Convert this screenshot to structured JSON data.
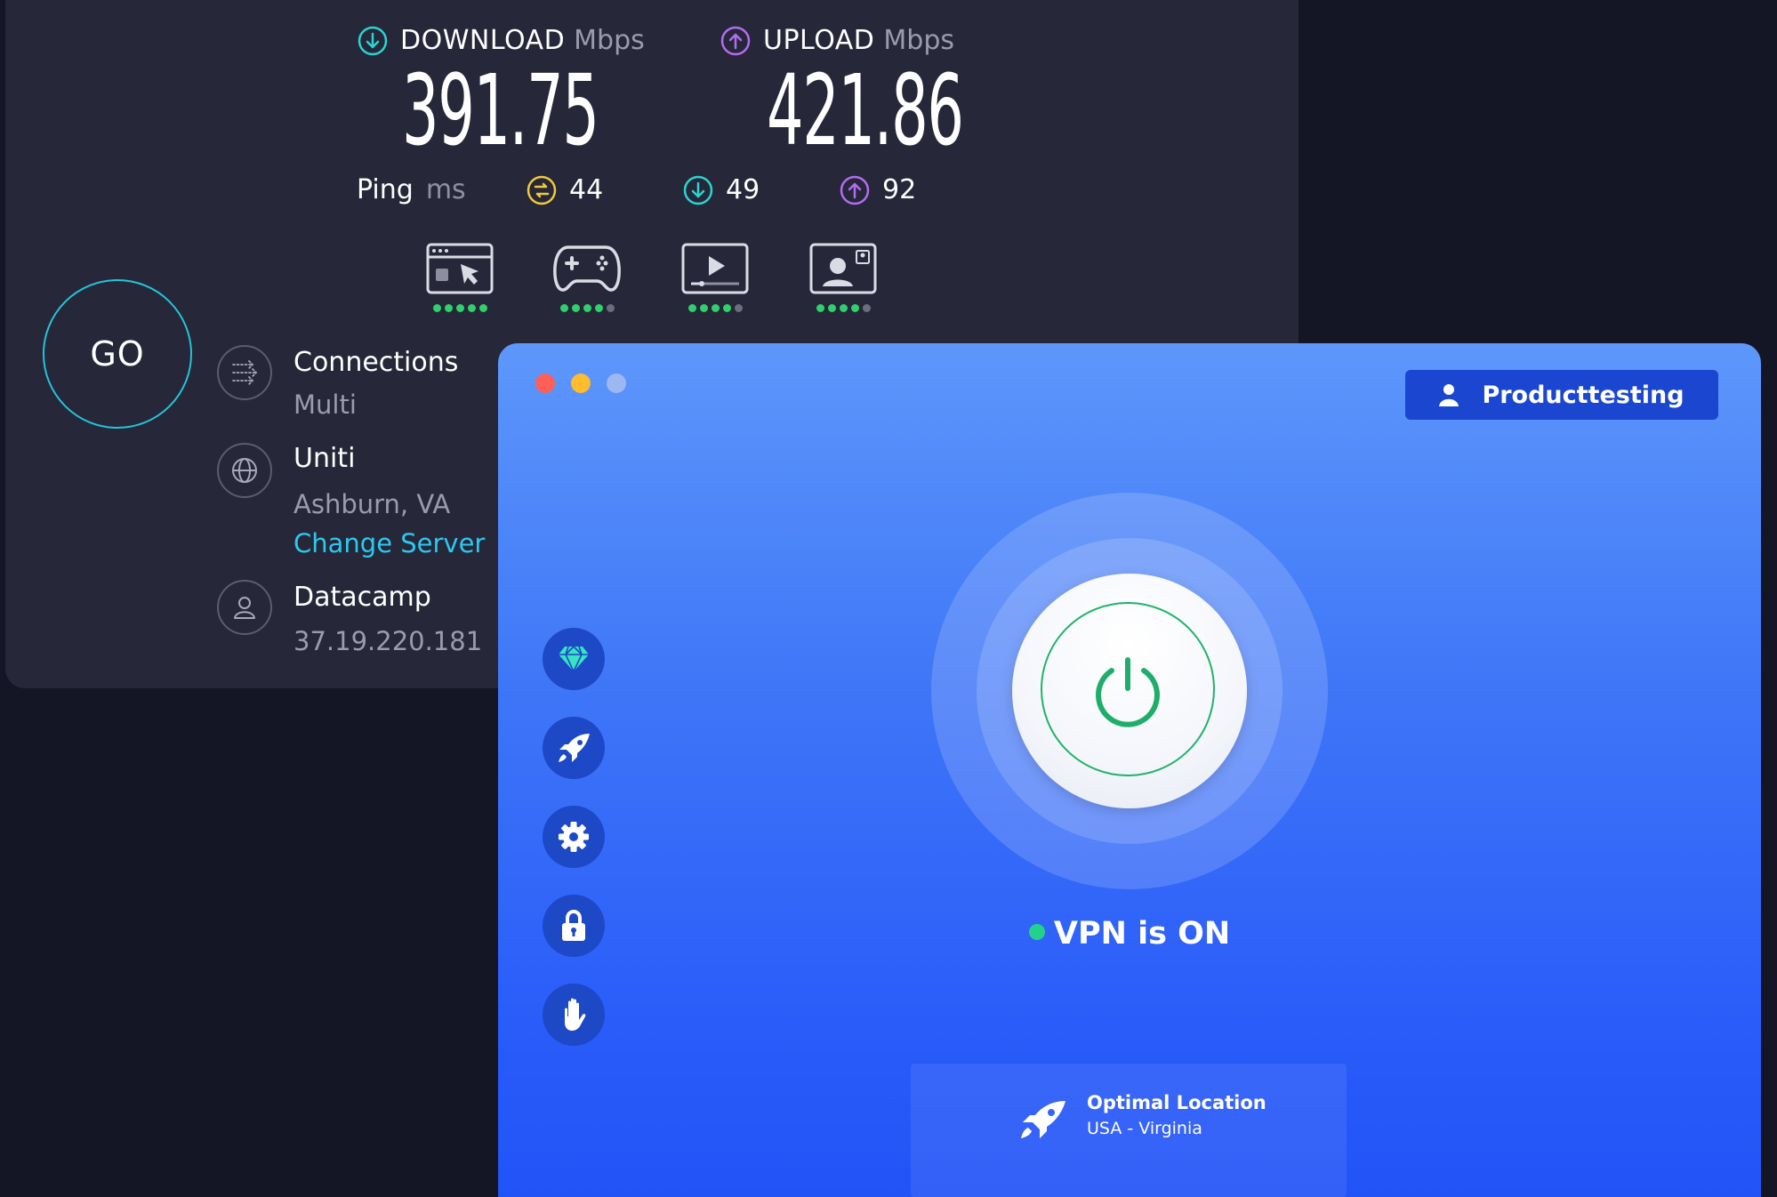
{
  "speedtest": {
    "download": {
      "label": "DOWNLOAD",
      "unit": "Mbps",
      "value": "391.75",
      "icon": "arrow-down-circle-icon",
      "color": "#2ad4d0"
    },
    "upload": {
      "label": "UPLOAD",
      "unit": "Mbps",
      "value": "421.86",
      "icon": "arrow-up-circle-icon",
      "color": "#b36cf0"
    },
    "ping": {
      "label": "Ping",
      "unit": "ms",
      "idle": {
        "value": "44",
        "icon": "ping-idle-icon",
        "color": "#f0c93c"
      },
      "download": {
        "value": "49",
        "icon": "arrow-down-circle-icon",
        "color": "#2ad4d0"
      },
      "upload": {
        "value": "92",
        "icon": "arrow-up-circle-icon",
        "color": "#b36cf0"
      }
    },
    "activities": [
      {
        "icon": "web-browsing-icon",
        "rating": 5
      },
      {
        "icon": "gaming-controller-icon",
        "rating": 4
      },
      {
        "icon": "video-streaming-icon",
        "rating": 4
      },
      {
        "icon": "video-call-icon",
        "rating": 4
      }
    ],
    "go_label": "GO",
    "connections": {
      "title": "Connections",
      "value": "Multi",
      "icon": "connections-icon"
    },
    "server": {
      "title": "Uniti",
      "location": "Ashburn, VA",
      "change_label": "Change Server",
      "icon": "globe-icon"
    },
    "provider": {
      "title": "Datacamp",
      "ip": "37.19.220.181",
      "icon": "user-icon"
    }
  },
  "vpn": {
    "username": "Producttesting",
    "status": "VPN is ON",
    "status_color": "#23d18b",
    "sidebar": [
      {
        "icon": "diamond-icon"
      },
      {
        "icon": "rocket-icon"
      },
      {
        "icon": "gear-icon"
      },
      {
        "icon": "lock-icon"
      },
      {
        "icon": "hand-icon"
      }
    ],
    "location": {
      "title": "Optimal Location",
      "subtitle": "USA - Virginia",
      "icon": "rocket-icon"
    }
  }
}
